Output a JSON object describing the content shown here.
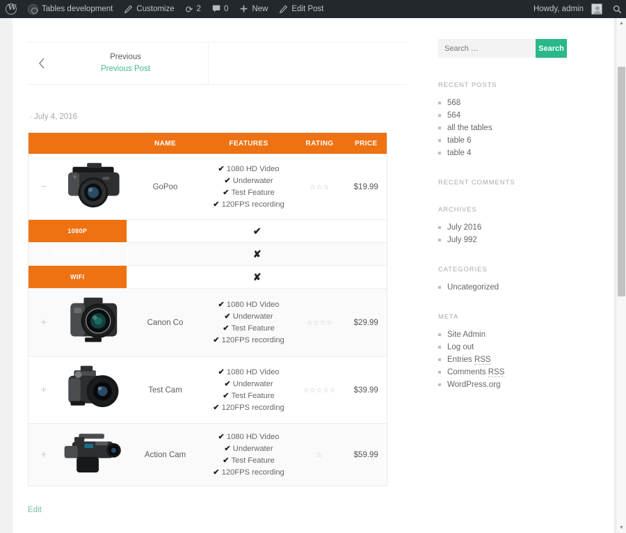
{
  "adminbar": {
    "wp_logo": "wordpress-logo-icon",
    "items": [
      {
        "name": "site-name",
        "icon": "site-icon",
        "label": "Tables development"
      },
      {
        "name": "customize",
        "icon": "pencil-icon",
        "label": "Customize"
      },
      {
        "name": "updates",
        "icon": "updates-icon",
        "label": "2"
      },
      {
        "name": "comments",
        "icon": "comment-bubble-icon",
        "label": "0"
      },
      {
        "name": "new-content",
        "icon": "plus-icon",
        "label": "New"
      },
      {
        "name": "edit-post",
        "icon": "pencil-icon",
        "label": "Edit Post"
      }
    ],
    "howdy": "Howdy, admin",
    "search_icon": "search-icon"
  },
  "post_nav": {
    "arrow": "chevron-left-icon",
    "prev_label": "Previous",
    "prev_title": "Previous Post"
  },
  "entry": {
    "meta": "· July 4, 2016",
    "edit_label": "Edit"
  },
  "colors": {
    "table_header_bg": "#ee7112",
    "search_button_bg": "#29b88a",
    "link_green": "#42b98e",
    "adminbar_bg": "#23282d"
  },
  "table": {
    "columns": [
      "",
      "",
      "NAME",
      "FEATURES",
      "RATING",
      "PRICE"
    ],
    "rows": [
      {
        "toggle": "−",
        "toggle_state": "expanded",
        "image": "dslr-camera-image",
        "name": "GoPoo",
        "features": [
          "1080 HD Video",
          "Underwater",
          "Test Feature",
          "120FPS recording"
        ],
        "rating": 3,
        "price": "$19.99",
        "subrows": [
          {
            "label": "1080P",
            "mark": "✔"
          },
          {
            "label": "WATERPROOF",
            "mark": "✘"
          },
          {
            "label": "WIFI",
            "mark": "✘"
          }
        ]
      },
      {
        "toggle": "+",
        "toggle_state": "collapsed",
        "image": "bridge-camera-image",
        "name": "Canon Co",
        "features": [
          "1080 HD Video",
          "Underwater",
          "Test Feature",
          "120FPS recording"
        ],
        "rating": 4,
        "price": "$29.99",
        "subrows": []
      },
      {
        "toggle": "+",
        "toggle_state": "collapsed",
        "image": "superzoom-camera-image",
        "name": "Test Cam",
        "features": [
          "1080 HD Video",
          "Underwater",
          "Test Feature",
          "120FPS recording"
        ],
        "rating": 5,
        "price": "$39.99",
        "subrows": []
      },
      {
        "toggle": "+",
        "toggle_state": "collapsed",
        "image": "camcorder-image",
        "name": "Action Cam",
        "features": [
          "1080 HD Video",
          "Underwater",
          "Test Feature",
          "120FPS recording"
        ],
        "rating": 1,
        "price": "$59.99",
        "subrows": []
      }
    ]
  },
  "sidebar": {
    "search": {
      "placeholder": "Search …",
      "button": "Search"
    },
    "widgets": [
      {
        "title": "RECENT POSTS",
        "items": [
          "568",
          "564",
          "all the tables",
          "table 6",
          "table 4"
        ]
      },
      {
        "title": "RECENT COMMENTS",
        "items": []
      },
      {
        "title": "ARCHIVES",
        "items": [
          "July 2016",
          "July 992"
        ]
      },
      {
        "title": "CATEGORIES",
        "items": [
          "Uncategorized"
        ]
      },
      {
        "title": "META",
        "items": [
          "Site Admin",
          "Log out",
          "Entries RSS",
          "Comments RSS",
          "WordPress.org"
        ]
      }
    ]
  },
  "scrollbar": {
    "up": "▲",
    "down": "▼"
  }
}
